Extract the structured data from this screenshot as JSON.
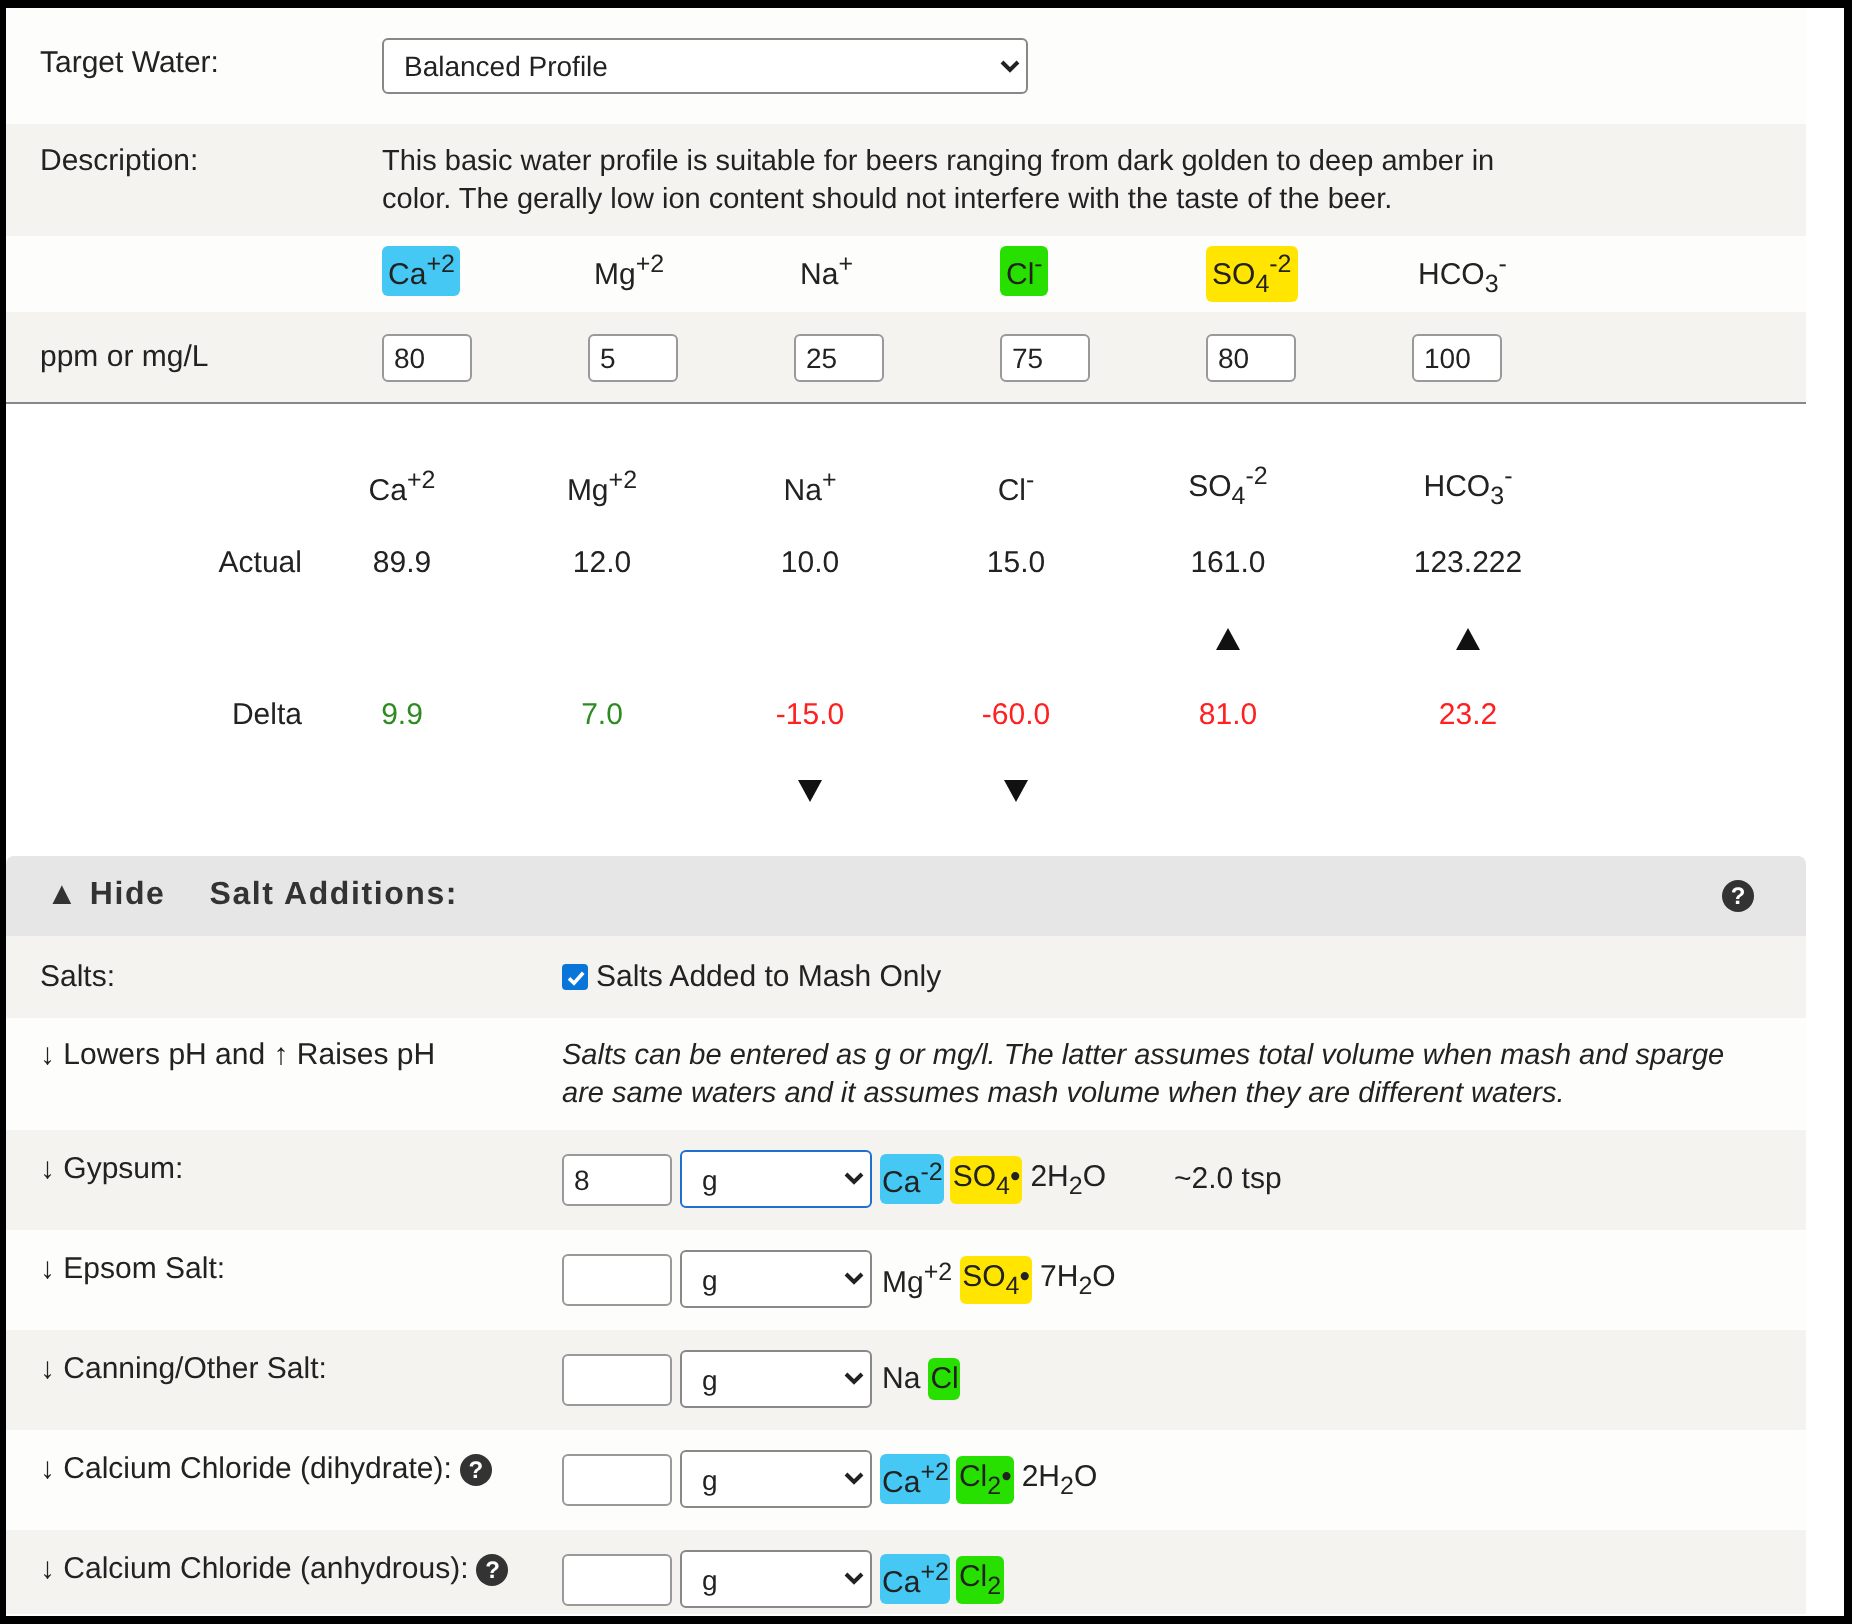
{
  "target_water": {
    "label": "Target Water:",
    "value": "Balanced Profile"
  },
  "description": {
    "label": "Description:",
    "text": "This basic water profile is suitable for beers ranging from dark golden to deep amber in color. The gerally low ion content should not interfere with the taste of the beer."
  },
  "ions": [
    {
      "name": "Ca$^{+2}$",
      "color": "#45c8f3"
    },
    {
      "name": "Mg$^{+2}$"
    },
    {
      "name": "Na$^{+}$"
    },
    {
      "name": "Cl$^{-}$",
      "color": "#28e000"
    },
    {
      "name": "SO$_{4}$$^{-2}$",
      "color": "#ffe500"
    },
    {
      "name": "HCO$_{3}$$^{-}$"
    }
  ],
  "ppm": {
    "label": "ppm or mg/L",
    "values": [
      "80",
      "5",
      "25",
      "75",
      "80",
      "100"
    ]
  },
  "results": {
    "actual_label": "Actual",
    "delta_label": "Delta",
    "columns": [
      {
        "ion": "Ca$^{+2}$",
        "actual": "89.9",
        "delta": "9.9",
        "in_range": true,
        "arrow_up": false,
        "arrow_down": false
      },
      {
        "ion": "Mg$^{+2}$",
        "actual": "12.0",
        "delta": "7.0",
        "in_range": true,
        "arrow_up": false,
        "arrow_down": false
      },
      {
        "ion": "Na$^{+}$",
        "actual": "10.0",
        "delta": "-15.0",
        "in_range": false,
        "arrow_up": false,
        "arrow_down": true
      },
      {
        "ion": "Cl$^{-}$",
        "actual": "15.0",
        "delta": "-60.0",
        "in_range": false,
        "arrow_up": false,
        "arrow_down": true
      },
      {
        "ion": "SO$_{4}$$^{-2}$",
        "actual": "161.0",
        "delta": "81.0",
        "in_range": false,
        "arrow_up": true,
        "arrow_down": false
      },
      {
        "ion": "HCO$_{3}$$^{-}$",
        "actual": "123.222",
        "delta": "23.2",
        "in_range": false,
        "arrow_up": true,
        "arrow_down": false
      }
    ]
  },
  "salt_section": {
    "toggle": "▲ Hide",
    "title": "Salt Additions:",
    "help": "?",
    "salts_label": "Salts:",
    "mash_only": {
      "label": "Salts Added to Mash Only",
      "checked": true
    },
    "ph_label": "↓ Lowers pH and ↑ Raises pH",
    "note": "Salts can be entered as g or mg/l. The latter assumes total volume when mash and sparge are same waters and it assumes mash volume when they are different waters.",
    "salts": [
      {
        "label": "↓ Gypsum:",
        "amount": "8",
        "unit": "g",
        "focused": true,
        "formula": [
          {
            "text": "Ca$^{-2}$",
            "color": "#45c8f3"
          },
          {
            "text": "SO$_{4}$•",
            "color": "#ffe500"
          },
          {
            "text": "2H$_{2}$O"
          }
        ],
        "tsp": "~2.0 tsp"
      },
      {
        "label": "↓ Epsom Salt:",
        "unit": "g",
        "focused": false,
        "formula": [
          {
            "text": "Mg$^{+2}$"
          },
          {
            "text": "SO$_{4}$•",
            "color": "#ffe500"
          },
          {
            "text": "7H$_{2}$O"
          }
        ]
      },
      {
        "label": "↓ Canning/Other Salt:",
        "unit": "g",
        "focused": false,
        "formula": [
          {
            "text": "Na"
          },
          {
            "text": "Cl",
            "color": "#28e000"
          }
        ]
      },
      {
        "label": "↓ Calcium Chloride (dihydrate):",
        "help": "?",
        "unit": "g",
        "focused": false,
        "formula": [
          {
            "text": "Ca$^{+2}$",
            "color": "#45c8f3"
          },
          {
            "text": "Cl$_{2}$•",
            "color": "#28e000"
          },
          {
            "text": "2H$_{2}$O"
          }
        ]
      },
      {
        "label": "↓ Calcium Chloride (anhydrous):",
        "help": "?",
        "unit": "g",
        "focused": false,
        "formula": [
          {
            "text": "Ca$^{+2}$",
            "color": "#45c8f3"
          },
          {
            "text": "Cl$_{2}$",
            "color": "#28e000"
          }
        ]
      }
    ]
  }
}
